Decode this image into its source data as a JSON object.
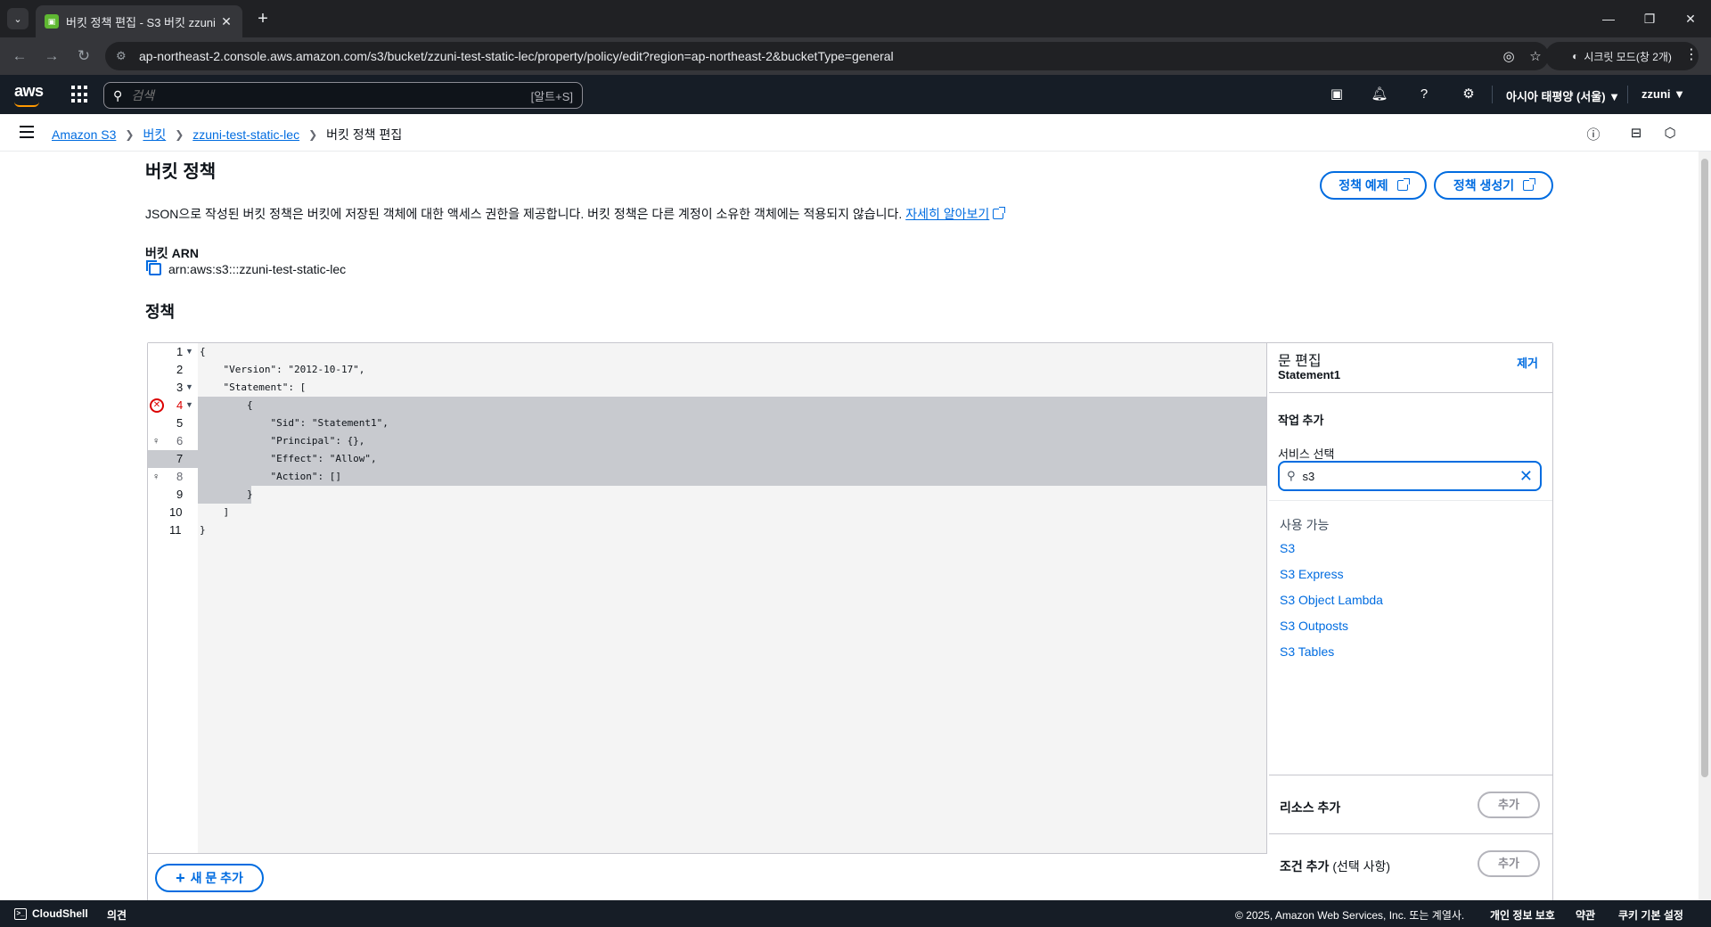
{
  "browser": {
    "tab_title": "버킷 정책 편집 - S3 버킷 zzuni",
    "url": "ap-northeast-2.console.aws.amazon.com/s3/bucket/zzuni-test-static-lec/property/policy/edit?region=ap-northeast-2&bucketType=general",
    "incognito_label": "시크릿 모드(창 2개)"
  },
  "aws_nav": {
    "logo": "aws",
    "search_placeholder": "검색",
    "search_shortcut": "[알트+S]",
    "region": "아시아 태평양 (서울) ▼",
    "user": "zzuni ▼"
  },
  "breadcrumb": {
    "items": [
      "Amazon S3",
      "버킷",
      "zzuni-test-static-lec"
    ],
    "current": "버킷 정책 편집"
  },
  "page": {
    "title": "버킷 정책",
    "description": "JSON으로 작성된 버킷 정책은 버킷에 저장된 객체에 대한 액세스 권한을 제공합니다. 버킷 정책은 다른 계정이 소유한 객체에는 적용되지 않습니다.",
    "learn_more": "자세히 알아보기",
    "btn_policy_examples": "정책 예제",
    "btn_policy_generator": "정책 생성기",
    "arn_label": "버킷 ARN",
    "arn_value": "arn:aws:s3:::zzuni-test-static-lec",
    "policy_heading": "정책",
    "add_statement": "새 문 추가"
  },
  "editor": {
    "line_numbers": [
      "1",
      "2",
      "3",
      "4",
      "5",
      "6",
      "7",
      "8",
      "9",
      "10",
      "11"
    ],
    "lines": [
      "{",
      "    \"Version\": \"2012-10-17\",",
      "    \"Statement\": [",
      "        {",
      "            \"Sid\": \"Statement1\",",
      "            \"Principal\": {},",
      "            \"Effect\": \"Allow\",",
      "            \"Action\": []",
      "        }",
      "    ]",
      "}"
    ]
  },
  "side_panel": {
    "title": "문 편집",
    "statement": "Statement1",
    "remove": "제거",
    "add_action": "작업 추가",
    "service_label": "서비스 선택",
    "service_value": "s3",
    "available_label": "사용 가능",
    "services": [
      "S3",
      "S3 Express",
      "S3 Object Lambda",
      "S3 Outposts",
      "S3 Tables"
    ],
    "add_resource": "리소스 추가",
    "add_condition": "조건 추가",
    "add_condition_optional": "(선택 사항)",
    "add_button": "추가"
  },
  "footer": {
    "cloudshell": "CloudShell",
    "feedback": "의견",
    "copyright": "© 2025, Amazon Web Services, Inc. 또는 계열사.",
    "privacy": "개인 정보 보호",
    "terms": "약관",
    "cookies": "쿠키 기본 설정"
  },
  "colors": {
    "link": "#006ce0",
    "nav_bg": "#161d26",
    "error": "#db0000",
    "selection": "#c8cacf"
  }
}
